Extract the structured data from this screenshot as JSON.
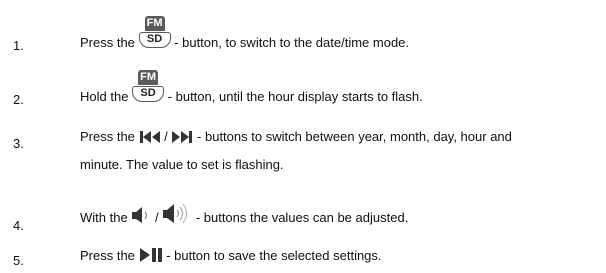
{
  "fm_label": "FM",
  "sd_label": "SD",
  "steps": [
    {
      "num": "1.",
      "pre": "Press the",
      "post": "- button, to switch to the date/time mode.",
      "icons": [
        "fm-sd-button"
      ]
    },
    {
      "num": "2.",
      "pre": "Hold the",
      "post": "- button, until the hour display starts to flash.",
      "icons": [
        "fm-sd-button"
      ]
    },
    {
      "num": "3.",
      "pre": "Press the",
      "sep": "/",
      "post": "- buttons to switch between year, month, day, hour and",
      "cont": "minute. The value to set is flashing.",
      "icons": [
        "skip-back-icon",
        "skip-forward-icon"
      ]
    },
    {
      "num": "4.",
      "pre": "With the",
      "sep": "/",
      "post": "- buttons the values can be adjusted.",
      "icons": [
        "volume-down-icon",
        "volume-up-icon"
      ]
    },
    {
      "num": "5.",
      "pre": "Press the",
      "post": "- button to save the selected settings.",
      "icons": [
        "play-pause-icon"
      ]
    }
  ]
}
